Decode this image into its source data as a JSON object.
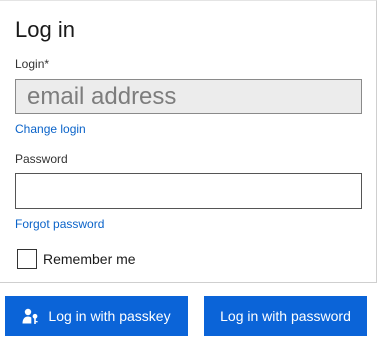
{
  "login_form": {
    "title": "Log in",
    "login_label": "Login*",
    "login_value": "email address",
    "change_login_link": "Change login",
    "password_label": "Password",
    "password_value": "",
    "forgot_password_link": "Forgot password",
    "remember_me_label": "Remember me",
    "remember_me_checked": false
  },
  "actions": {
    "passkey_button_label": "Log in with passkey",
    "passkey_icon": "user-key-icon",
    "password_button_label": "Log in with password"
  },
  "colors": {
    "primary_button": "#0b64d8",
    "link": "#0a63c9",
    "disabled_field_bg": "#ececec"
  }
}
